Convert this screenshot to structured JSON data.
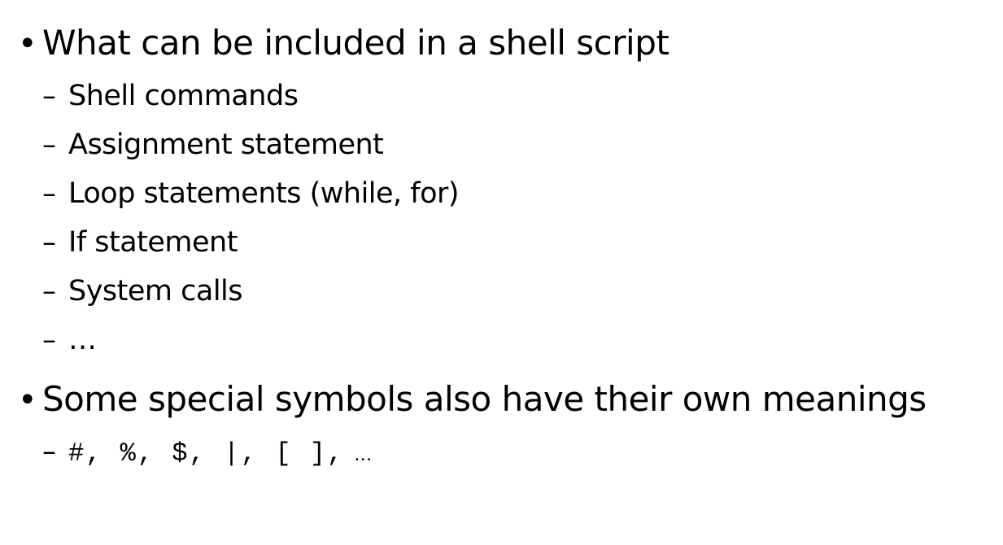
{
  "slide": {
    "bullets": [
      {
        "text": "What can be included in a shell script",
        "subitems": [
          "Shell commands",
          "Assignment statement",
          "Loop statements (while, for)",
          "If statement",
          "System calls",
          "…"
        ]
      },
      {
        "text": "Some special symbols also have their own meanings",
        "symbols": "#, %, $, |, [ ],",
        "symbols_tail": "…"
      }
    ],
    "bullet_glyph": "•",
    "dash_glyph": "–"
  }
}
